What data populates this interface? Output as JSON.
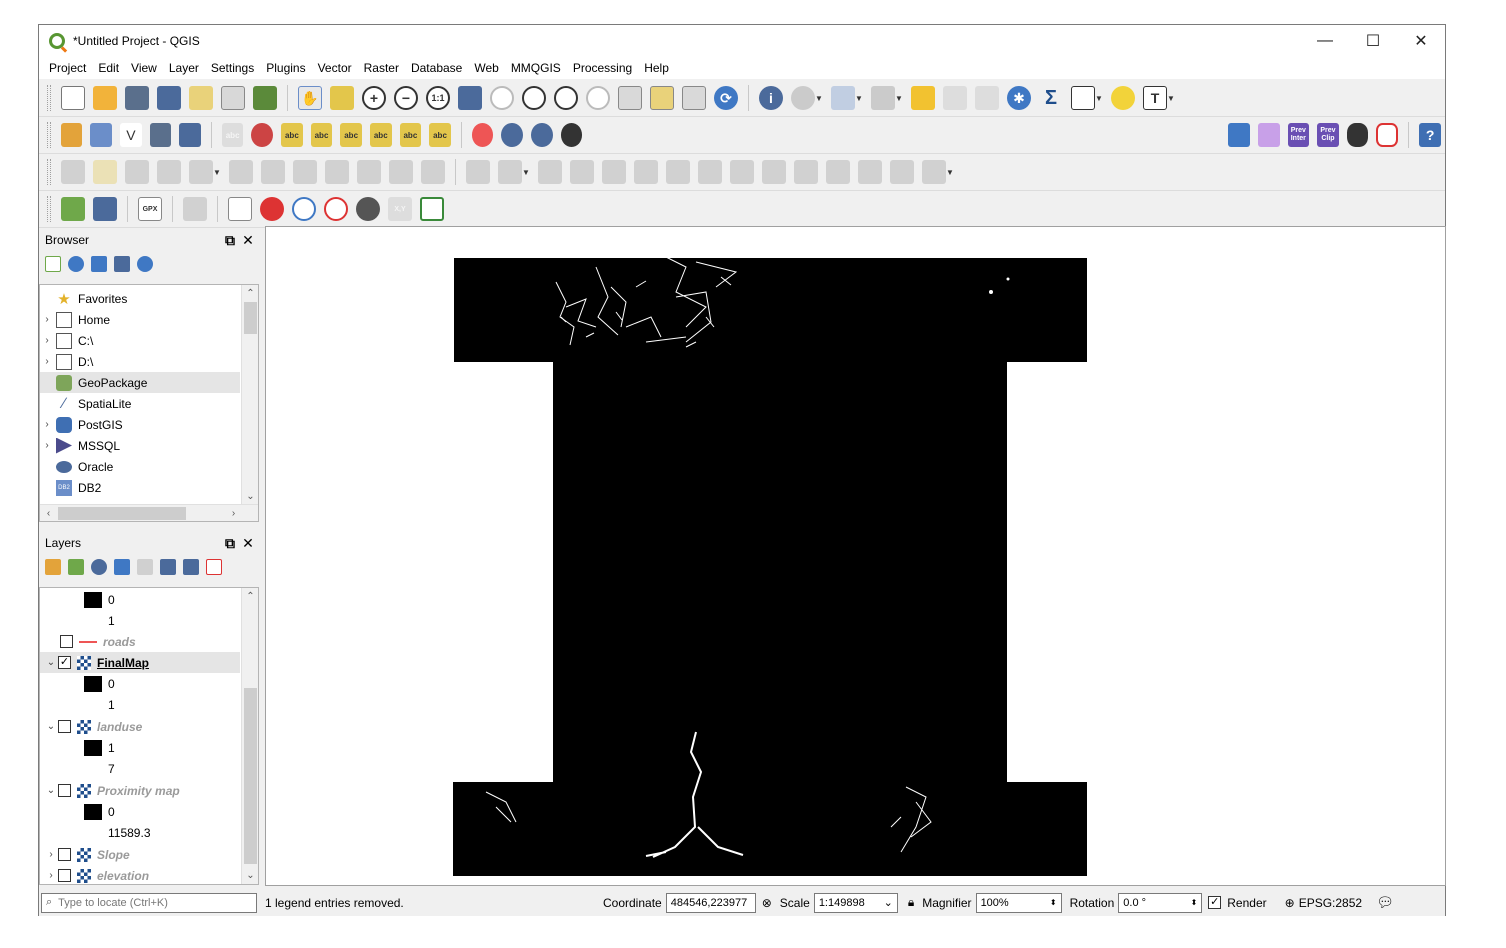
{
  "window": {
    "title": "*Untitled Project - QGIS",
    "minimize": "—",
    "maximize": "☐",
    "close": "✕"
  },
  "menu": [
    "Project",
    "Edit",
    "View",
    "Layer",
    "Settings",
    "Plugins",
    "Vector",
    "Raster",
    "Database",
    "Web",
    "MMQGIS",
    "Processing",
    "Help"
  ],
  "toolbar_icons": {
    "row1": [
      "new-project",
      "open-project",
      "save-project",
      "save-as",
      "new-print-layout",
      "layout-manager",
      "style-manager",
      "pan",
      "pan-to-selection",
      "zoom-in",
      "zoom-out",
      "zoom-native",
      "zoom-full",
      "zoom-to-selection",
      "zoom-to-layer",
      "zoom-last",
      "zoom-next",
      "new-bookmark",
      "show-bookmarks",
      "new-map-view",
      "refresh",
      "identify",
      "action",
      "select-features",
      "deselect",
      "open-attribute-table",
      "open-field-calculator",
      "statistics",
      "toolbox",
      "sum",
      "measure",
      "map-tips",
      "text-annotation"
    ],
    "row2": [
      "add-vector",
      "add-geopackage",
      "new-shapefile",
      "digitize",
      "add-csv",
      "label-tool",
      "pin-label",
      "label-a",
      "label-b",
      "label-c",
      "label-d",
      "label-e",
      "label-f",
      "coordinate-capture",
      "osm",
      "web-globe",
      "quickmapservices",
      "python",
      "plugin-a",
      "prev-inter",
      "prev-clip",
      "binoculars",
      "hexagon",
      "help"
    ],
    "row3": [
      "edit-pencil",
      "toggle-edit",
      "save-edits",
      "add-feature",
      "vertex-tool",
      "delete",
      "cut",
      "copy",
      "paste",
      "undo",
      "redo",
      "digitize-rectangle",
      "add-ring",
      "add-part",
      "fill-ring",
      "delete-ring",
      "delete-part",
      "reshape",
      "offset",
      "reverse",
      "split",
      "split-parts",
      "merge",
      "merge-attributes",
      "rotate"
    ],
    "row4": [
      "georeferencer",
      "layer-plugin",
      "gpx-tools",
      "select-by-location",
      "new-memory-layer",
      "pin",
      "zoom-magnifier",
      "zoom-select",
      "globe",
      "xy-tool",
      "bbox"
    ]
  },
  "status_texts": {
    "prev_inter_line1": "Prev",
    "prev_inter_line2": "Inter",
    "prev_clip_line1": "Prev",
    "prev_clip_line2": "Clip",
    "gpx": "GPX",
    "xy": "X,Y",
    "abc": "abc",
    "sum": "Σ",
    "text_t": "T",
    "help": "?"
  },
  "browser": {
    "title": "Browser",
    "items": [
      {
        "label": "Favorites",
        "arrow": "",
        "icon": "star-icon"
      },
      {
        "label": "Home",
        "arrow": "›",
        "icon": "home-folder-icon"
      },
      {
        "label": "C:\\",
        "arrow": "›",
        "icon": "folder-icon"
      },
      {
        "label": "D:\\",
        "arrow": "›",
        "icon": "folder-icon"
      },
      {
        "label": "GeoPackage",
        "arrow": "",
        "icon": "geopackage-icon"
      },
      {
        "label": "SpatiaLite",
        "arrow": "",
        "icon": "spatialite-icon"
      },
      {
        "label": "PostGIS",
        "arrow": "›",
        "icon": "postgis-icon"
      },
      {
        "label": "MSSQL",
        "arrow": "›",
        "icon": "mssql-icon"
      },
      {
        "label": "Oracle",
        "arrow": "",
        "icon": "oracle-icon"
      },
      {
        "label": "DB2",
        "arrow": "",
        "icon": "db2-icon"
      }
    ],
    "selected": "GeoPackage",
    "db2_badge": "DB2"
  },
  "layers": {
    "title": "Layers",
    "rows": [
      {
        "kind": "legend",
        "label": "0",
        "swatch": true
      },
      {
        "kind": "legend",
        "label": "1",
        "swatch": false
      },
      {
        "kind": "layer",
        "label": "roads",
        "checked": false,
        "arrow": "",
        "type": "line",
        "style": "italic-gray"
      },
      {
        "kind": "layer",
        "label": "FinalMap",
        "checked": true,
        "arrow": "⌄",
        "type": "raster",
        "style": "bold-underline"
      },
      {
        "kind": "legend",
        "label": "0",
        "swatch": true
      },
      {
        "kind": "legend",
        "label": "1",
        "swatch": false
      },
      {
        "kind": "layer",
        "label": "landuse",
        "checked": false,
        "arrow": "⌄",
        "type": "raster",
        "style": "italic-gray"
      },
      {
        "kind": "legend",
        "label": "1",
        "swatch": true
      },
      {
        "kind": "legend",
        "label": "7",
        "swatch": false
      },
      {
        "kind": "layer",
        "label": "Proximity map",
        "checked": false,
        "arrow": "⌄",
        "type": "raster",
        "style": "italic-gray"
      },
      {
        "kind": "legend",
        "label": "0",
        "swatch": true
      },
      {
        "kind": "legend",
        "label": "11589.3",
        "swatch": false
      },
      {
        "kind": "layer",
        "label": "Slope",
        "checked": false,
        "arrow": "›",
        "type": "raster",
        "style": "italic-gray"
      },
      {
        "kind": "layer",
        "label": "elevation",
        "checked": false,
        "arrow": "›",
        "type": "raster",
        "style": "italic-gray"
      }
    ]
  },
  "status": {
    "locate_placeholder": "Type to locate (Ctrl+K)",
    "message": "1 legend entries removed.",
    "coordinate_label": "Coordinate",
    "coordinate_value": "484546,223977",
    "scale_label": "Scale",
    "scale_value": "1:149898",
    "magnifier_label": "Magnifier",
    "magnifier_value": "100%",
    "rotation_label": "Rotation",
    "rotation_value": "0.0 °",
    "render_label": "Render",
    "render_checked": true,
    "crs": "EPSG:2852"
  },
  "colors": {
    "accent_green": "#589632",
    "accent_orange": "#ee7913",
    "map_fill": "#000000",
    "selection": "#e5e5e5"
  }
}
